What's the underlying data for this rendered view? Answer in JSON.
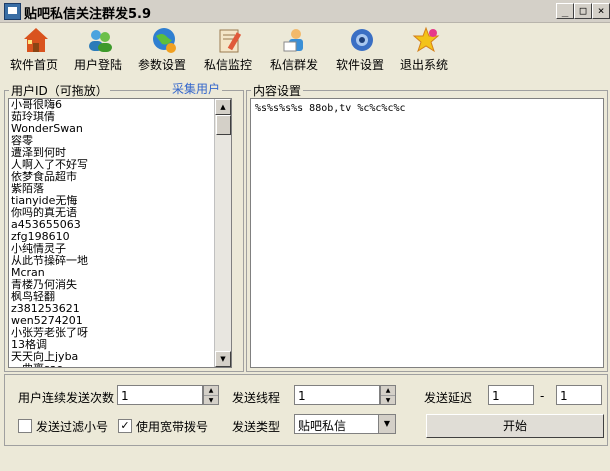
{
  "window": {
    "title": "贴吧私信关注群发5.9",
    "min": "_",
    "max": "□",
    "close": "×"
  },
  "toolbar": [
    {
      "label": "软件首页",
      "icon": "home-icon"
    },
    {
      "label": "用户登陆",
      "icon": "users-icon"
    },
    {
      "label": "参数设置",
      "icon": "globe-settings-icon"
    },
    {
      "label": "私信监控",
      "icon": "monitor-edit-icon"
    },
    {
      "label": "私信群发",
      "icon": "mail-send-icon"
    },
    {
      "label": "软件设置",
      "icon": "gear-icon"
    },
    {
      "label": "退出系统",
      "icon": "star-exit-icon"
    }
  ],
  "users_panel": {
    "legend": "用户ID（可拖放）",
    "collect_link": "采集用户",
    "items": [
      "小哥很嗨6",
      "茹玲琪倩",
      "WonderSwan",
      "容零",
      "遭泽到何时",
      "人啊入了不好写",
      "依梦食品超市",
      "紫陌落",
      "tianyide无悔",
      "你吗的真无语",
      "a453655063",
      "zfg198610",
      "小纯情灵子",
      "从此节操碎一地",
      "Mcran",
      "青楼乃何消失",
      "枫鸟轻翻",
      "z381253621",
      "wen5274201",
      "小张芳老张了呀",
      "13格调",
      "天天向上jyba",
      "一曲离sao"
    ]
  },
  "content_panel": {
    "legend": "内容设置",
    "text": "%s%s%s%s  88ob,tv %c%c%c%c"
  },
  "settings": {
    "send_count_label": "用户连续发送次数",
    "send_count_value": "1",
    "threads_label": "发送线程",
    "threads_value": "1",
    "delay_label": "发送延迟",
    "delay_from": "1",
    "delay_sep": "-",
    "delay_to": "1",
    "filter_label": "发送过滤小号",
    "filter_checked": false,
    "broadband_label": "使用宽带拨号",
    "broadband_checked": true,
    "send_type_label": "发送类型",
    "send_type_value": "贴吧私信",
    "start_label": "开始"
  }
}
